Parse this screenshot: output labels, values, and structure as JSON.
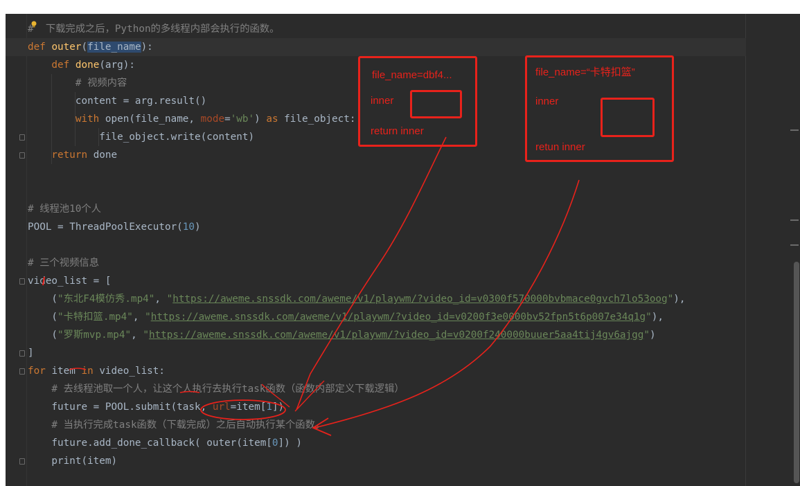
{
  "editor": {
    "lines": [
      [
        {
          "t": "#",
          "c": "cm"
        },
        {
          "t": "  下载完成之后，Python的多线程内部会执行的函数。",
          "c": "cm"
        }
      ],
      [
        {
          "t": "def ",
          "c": "kw"
        },
        {
          "t": "outer",
          "c": "fn"
        },
        {
          "t": "(",
          "c": "p"
        },
        {
          "t": "file_name",
          "c": "hl"
        },
        {
          "t": "):",
          "c": "p"
        }
      ],
      [
        {
          "t": "    def ",
          "c": "kw"
        },
        {
          "t": "done",
          "c": "fn"
        },
        {
          "t": "(arg):",
          "c": "p"
        }
      ],
      [
        {
          "t": "        # 视频内容",
          "c": "cm"
        }
      ],
      [
        {
          "t": "        content = arg.result()",
          "c": "p"
        }
      ],
      [
        {
          "t": "        with ",
          "c": "kw"
        },
        {
          "t": "open",
          "c": "p"
        },
        {
          "t": "(file_name, ",
          "c": "p"
        },
        {
          "t": "mode",
          "c": "named"
        },
        {
          "t": "=",
          "c": "p"
        },
        {
          "t": "'wb'",
          "c": "str"
        },
        {
          "t": ") ",
          "c": "p"
        },
        {
          "t": "as ",
          "c": "kw"
        },
        {
          "t": "file_object:",
          "c": "p"
        }
      ],
      [
        {
          "t": "            file_object.write(content)",
          "c": "p"
        }
      ],
      [
        {
          "t": "    return ",
          "c": "kw"
        },
        {
          "t": "done",
          "c": "p"
        }
      ],
      [],
      [],
      [
        {
          "t": "# 线程池10个人",
          "c": "cm"
        }
      ],
      [
        {
          "t": "POOL = ThreadPoolExecutor(",
          "c": "p"
        },
        {
          "t": "10",
          "c": "num"
        },
        {
          "t": ")",
          "c": "p"
        }
      ],
      [],
      [
        {
          "t": "# 三个视频信息",
          "c": "cm"
        }
      ],
      [
        {
          "t": "video_list = [",
          "c": "p"
        }
      ],
      [
        {
          "t": "    (",
          "c": "p"
        },
        {
          "t": "\"东北F4模仿秀.mp4\"",
          "c": "str"
        },
        {
          "t": ", ",
          "c": "p"
        },
        {
          "t": "\"",
          "c": "str"
        },
        {
          "t": "https://aweme.snssdk.com/aweme/v1/playwm/?video_id=v0300f570000bvbmace0gvch7lo53oog",
          "c": "url"
        },
        {
          "t": "\"",
          "c": "str"
        },
        {
          "t": "),",
          "c": "p"
        }
      ],
      [
        {
          "t": "    (",
          "c": "p"
        },
        {
          "t": "\"卡特扣篮.mp4\"",
          "c": "str"
        },
        {
          "t": ", ",
          "c": "p"
        },
        {
          "t": "\"",
          "c": "str"
        },
        {
          "t": "https://aweme.snssdk.com/aweme/v1/playwm/?video_id=v0200f3e0000bv52fpn5t6p007e34q1g",
          "c": "url"
        },
        {
          "t": "\"",
          "c": "str"
        },
        {
          "t": "),",
          "c": "p"
        }
      ],
      [
        {
          "t": "    (",
          "c": "p"
        },
        {
          "t": "\"罗斯mvp.mp4\"",
          "c": "str"
        },
        {
          "t": ", ",
          "c": "p"
        },
        {
          "t": "\"",
          "c": "str"
        },
        {
          "t": "https://aweme.snssdk.com/aweme/v1/playwm/?video_id=v0200f240000buuer5aa4tij4gv6ajgg",
          "c": "url"
        },
        {
          "t": "\"",
          "c": "str"
        },
        {
          "t": ")",
          "c": "p"
        }
      ],
      [
        {
          "t": "]",
          "c": "p"
        }
      ],
      [
        {
          "t": "for ",
          "c": "kw"
        },
        {
          "t": "item ",
          "c": "p"
        },
        {
          "t": "in ",
          "c": "kw"
        },
        {
          "t": "video_list:",
          "c": "p"
        }
      ],
      [
        {
          "t": "    # 去线程池取一个人，让这个人执行去执行task函数（函数内部定义下载逻辑）",
          "c": "cm"
        }
      ],
      [
        {
          "t": "    future = POOL.submit(task, ",
          "c": "p"
        },
        {
          "t": "url",
          "c": "named"
        },
        {
          "t": "=item[",
          "c": "p"
        },
        {
          "t": "1",
          "c": "num"
        },
        {
          "t": "])",
          "c": "p"
        }
      ],
      [
        {
          "t": "    # 当执行完成task函数（下载完成）之后自动执行某个函数。",
          "c": "cm"
        }
      ],
      [
        {
          "t": "    future.add_done_callback( outer(item[",
          "c": "p"
        },
        {
          "t": "0",
          "c": "num"
        },
        {
          "t": "]) )",
          "c": "p"
        }
      ],
      [
        {
          "t": "    print(item)",
          "c": "p"
        }
      ]
    ]
  },
  "annotations": {
    "box1": {
      "line1": "file_name=dbf4...",
      "line2": "inner",
      "line3": "return inner"
    },
    "box2": {
      "line1": "file_name=“卡特扣篮”",
      "line2": "inner",
      "line3": "retun inner"
    }
  },
  "colors": {
    "annotation": "#e8221b",
    "editor_bg": "#2b2b2b"
  }
}
